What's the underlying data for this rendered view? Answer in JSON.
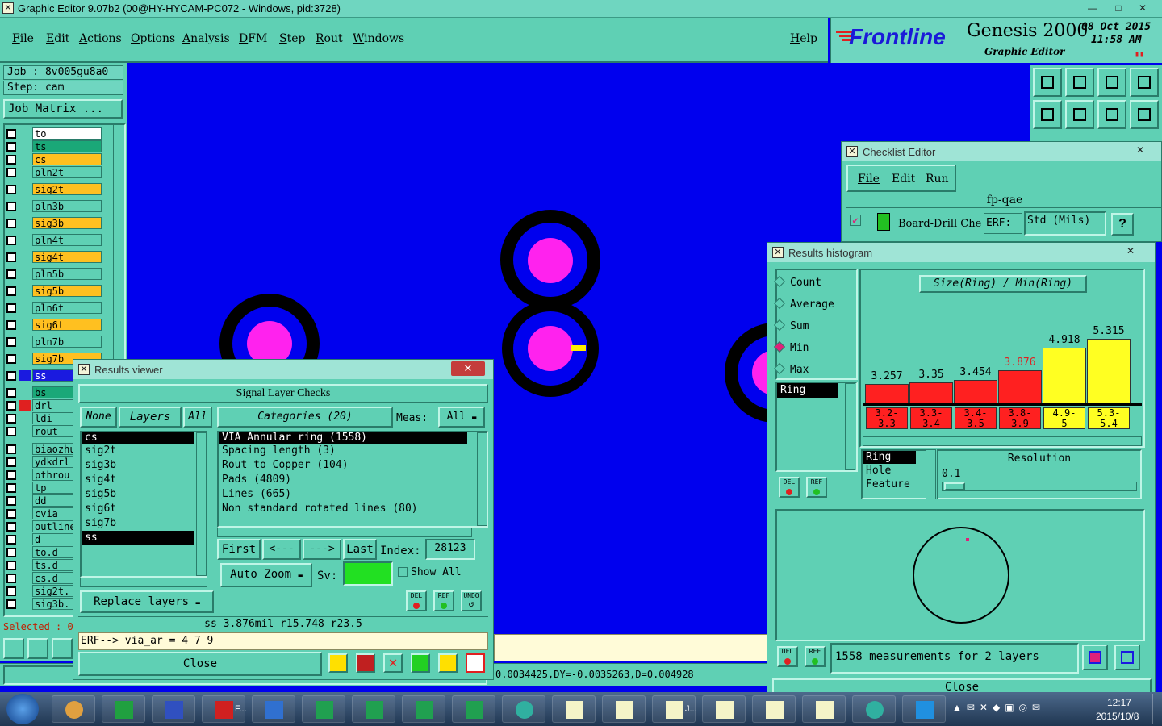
{
  "window": {
    "title": "Graphic Editor 9.07b2 (00@HY-HYCAM-PC072 - Windows, pid:3728)",
    "min": "—",
    "max": "□",
    "close": "✕"
  },
  "menu": [
    "File",
    "Edit",
    "Actions",
    "Options",
    "Analysis",
    "DFM",
    "Step",
    "Rout",
    "Windows"
  ],
  "help": "Help",
  "brand": {
    "logo": "Frontline",
    "product": "Genesis 2000",
    "subtitle": "Graphic Editor",
    "date": "08 Oct 2015",
    "time": "11:58 AM"
  },
  "job": {
    "job_line": "Job : 8v005gu8a0",
    "step_line": "Step: cam",
    "matrix_button": "Job Matrix ..."
  },
  "layers": [
    {
      "name": "to",
      "color": "#ffffff"
    },
    {
      "name": "ts",
      "color": "#1aa878"
    },
    {
      "name": "cs",
      "color": "#ffc020"
    },
    {
      "name": "pln2t",
      "color": "#5fd0b4"
    },
    {
      "name": "sig2t",
      "color": "#ffc020"
    },
    {
      "name": "pln3b",
      "color": "#5fd0b4"
    },
    {
      "name": "sig3b",
      "color": "#ffc020"
    },
    {
      "name": "pln4t",
      "color": "#5fd0b4"
    },
    {
      "name": "sig4t",
      "color": "#ffc020"
    },
    {
      "name": "pln5b",
      "color": "#5fd0b4"
    },
    {
      "name": "sig5b",
      "color": "#ffc020"
    },
    {
      "name": "pln6t",
      "color": "#5fd0b4"
    },
    {
      "name": "sig6t",
      "color": "#ffc020"
    },
    {
      "name": "pln7b",
      "color": "#5fd0b4"
    },
    {
      "name": "sig7b",
      "color": "#ffc020"
    },
    {
      "name": "ss",
      "color": "#1a1ae0"
    },
    {
      "name": "bs",
      "color": "#1aa878"
    }
  ],
  "layers2": [
    "drl",
    "ldi",
    "rout"
  ],
  "layers3": [
    "biaozhu",
    "ydkdrl",
    "pthrou",
    "tp",
    "dd",
    "cvia",
    "outline",
    "d",
    "to.d",
    "ts.d",
    "cs.d",
    "sig2t.",
    "sig3b."
  ],
  "selected_label": "Selected : 0",
  "results_viewer": {
    "title": "Results viewer",
    "header": "Signal Layer Checks",
    "none_btn": "None",
    "layers_btn": "Layers",
    "all_btn": "All",
    "categories_btn": "Categories (20)",
    "meas_label": "Meas:",
    "meas_value": "All",
    "layer_list": [
      "cs",
      "sig2t",
      "sig3b",
      "sig4t",
      "sig5b",
      "sig6t",
      "sig7b",
      "ss"
    ],
    "category_list": [
      "VIA Annular ring (1558)",
      "Spacing length (3)",
      "Rout to Copper (104)",
      "Pads (4809)",
      "Lines (665)",
      "Non standard rotated lines (80)"
    ],
    "first": "First",
    "prev": "<---",
    "next": "--->",
    "last": "Last",
    "index_label": "Index:",
    "index_value": "28123",
    "auto_zoom": "Auto Zoom",
    "sv_label": "Sv:",
    "show_all": "Show All",
    "replace_layers": "Replace layers",
    "status": "ss 3.876mil   r15.748   r23.5",
    "erf": "ERF--> via_ar = 4 7 9",
    "close": "Close",
    "del": "DEL",
    "ref": "REF",
    "undo": "UNDO"
  },
  "coords": "0.0034425,DY=-0.0035263,D=0.004928",
  "checklist_editor": {
    "title": "Checklist Editor",
    "menu": [
      "File",
      "Edit",
      "Run"
    ],
    "name": "fp-qae",
    "row_label": "Board-Drill Che",
    "erf_label": "ERF:",
    "erf_value": "Std (Mils)",
    "help": "?"
  },
  "histogram": {
    "title": "Results histogram",
    "modes": [
      "Count",
      "Average",
      "Sum",
      "Min",
      "Max"
    ],
    "selected_mode": "Min",
    "chart_title": "Size(Ring) / Min(Ring)",
    "attr_list": [
      "Ring"
    ],
    "values": [
      "3.257",
      "3.35",
      "3.454",
      "3.876",
      "4.918",
      "5.315"
    ],
    "bins": [
      [
        "3.2-",
        "3.3"
      ],
      [
        "3.3-",
        "3.4"
      ],
      [
        "3.4-",
        "3.5"
      ],
      [
        "3.8-",
        "3.9"
      ],
      [
        "4.9-",
        "5"
      ],
      [
        "5.3-",
        "5.4"
      ]
    ],
    "kinds": [
      "Ring",
      "Hole",
      "Feature"
    ],
    "resolution_label": "Resolution",
    "resolution_value": "0.1",
    "summary": "1558 measurements for 2 layers",
    "close": "Close"
  },
  "chart_data": {
    "type": "bar",
    "title": "Size(Ring) / Min(Ring)",
    "categories": [
      "3.2-3.3",
      "3.3-3.4",
      "3.4-3.5",
      "3.8-3.9",
      "4.9-5",
      "5.3-5.4"
    ],
    "values": [
      3.257,
      3.35,
      3.454,
      3.876,
      4.918,
      5.315
    ],
    "bar_colors": [
      "#ff2020",
      "#ff2020",
      "#ff2020",
      "#ff2020",
      "#ffff22",
      "#ffff22"
    ]
  },
  "taskbar": {
    "time": "12:17",
    "date": "2015/10/8",
    "labels": [
      "F...",
      "J..."
    ]
  }
}
